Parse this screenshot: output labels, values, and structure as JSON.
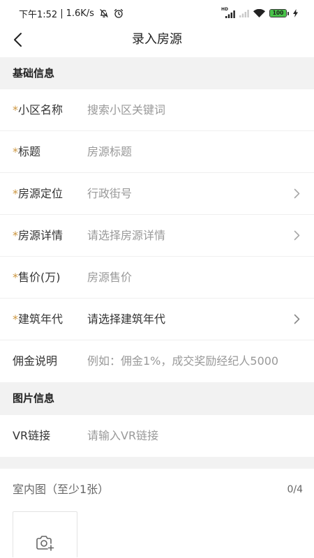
{
  "theme": {
    "text": "#333333",
    "placeholder": "#999999",
    "accent": "#cc9640",
    "section_bg": "#f2f2f2",
    "divider": "#efefef",
    "battery": "#49c34a",
    "status_text": "#222222"
  },
  "status_bar": {
    "time": "下午1:52",
    "separator": "|",
    "net_speed": "1.6K/s",
    "signal_badge": "HD",
    "battery_level": "100",
    "icons": [
      "bell-off-icon",
      "alarm-clock-icon",
      "signal-icon",
      "signal-weak-icon",
      "wifi-icon",
      "battery-icon",
      "charging-icon"
    ]
  },
  "header": {
    "back_icon": "chevron-left-icon",
    "title": "录入房源"
  },
  "form": {
    "required_mark": "*",
    "basic": {
      "title": "基础信息",
      "rows": [
        {
          "required": true,
          "label": "小区名称",
          "placeholder": "搜索小区关键词",
          "chevron": false
        },
        {
          "required": true,
          "label": "标题",
          "placeholder": "房源标题",
          "chevron": false
        },
        {
          "required": true,
          "label": "房源定位",
          "placeholder": "行政街号",
          "chevron": true
        },
        {
          "required": true,
          "label": "房源详情",
          "placeholder": "请选择房源详情",
          "chevron": true
        },
        {
          "required": true,
          "label": "售价(万)",
          "placeholder": "房源售价",
          "chevron": false
        },
        {
          "required": true,
          "label": "建筑年代",
          "value": "请选择建筑年代",
          "chevron": true
        },
        {
          "required": false,
          "label": "佣金说明",
          "placeholder": "例如：佣金1%，成交奖励经纪人5000",
          "chevron": false
        }
      ]
    },
    "images": {
      "title": "图片信息",
      "rows": [
        {
          "required": false,
          "label": "VR链接",
          "placeholder": "请输入VR链接",
          "chevron": false
        }
      ],
      "indoor": {
        "label": "室内图（至少1张）",
        "count": "0/4",
        "upload_icon": "camera-add-icon"
      }
    }
  }
}
